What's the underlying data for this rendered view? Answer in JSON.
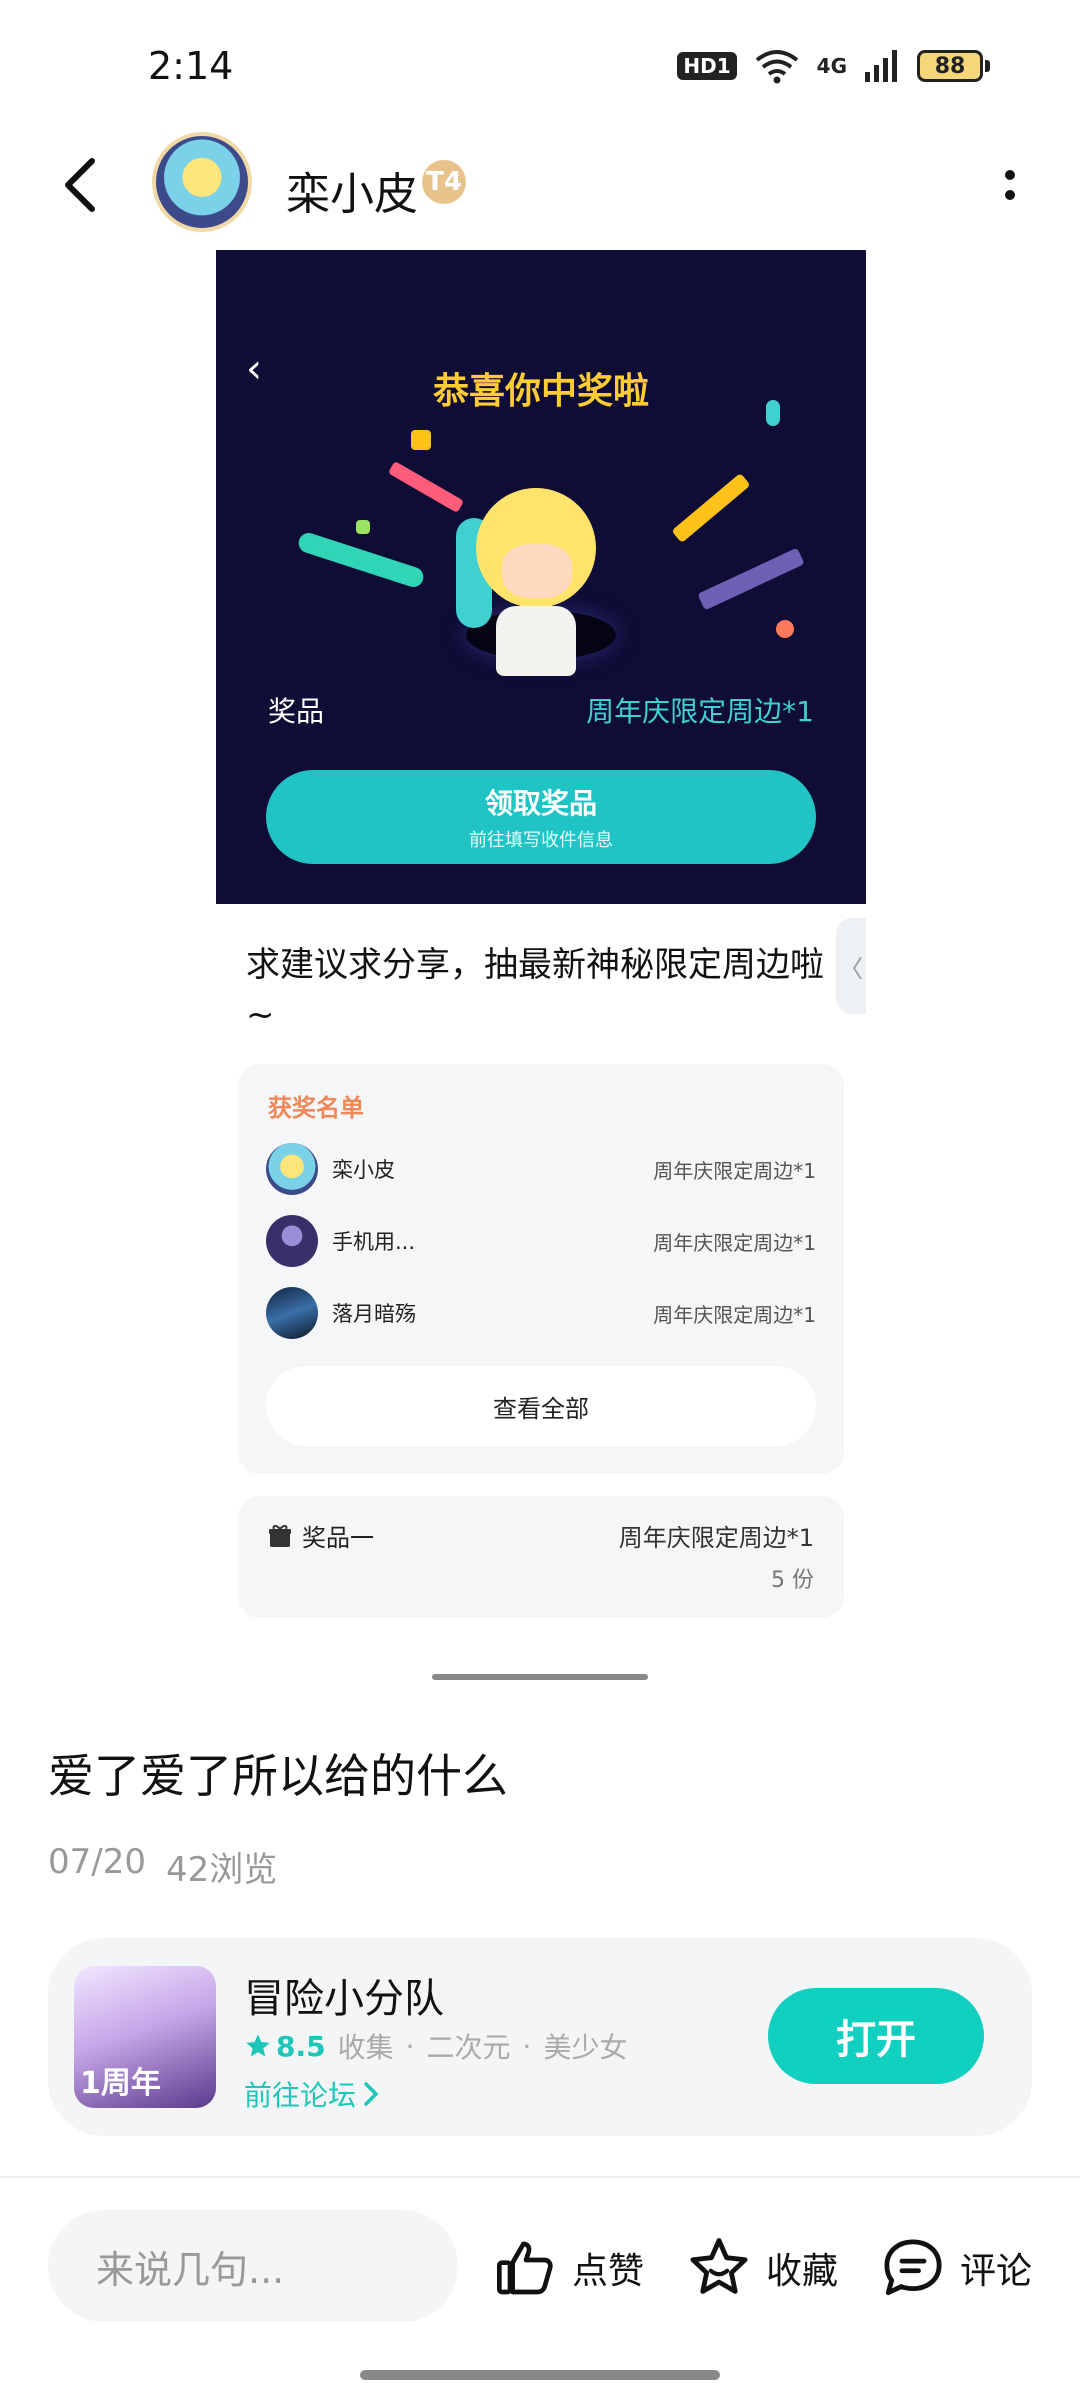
{
  "status_bar": {
    "time": "2:14",
    "network": "4G",
    "hd_label": "HD1",
    "battery": "88"
  },
  "header": {
    "user_name": "栾小皮",
    "level": "T4"
  },
  "post_image": {
    "title": "恭喜你中奖啦",
    "prize_label": "奖品",
    "prize_value": "周年庆限定周边*1",
    "claim_button": "领取奖品",
    "claim_sub": "前往填写收件信息",
    "description": "求建议求分享，抽最新神秘限定周边啦~",
    "side_handle": "〈",
    "winners_title": "获奖名单",
    "winners": [
      {
        "name": "栾小皮",
        "prize": "周年庆限定周边*1"
      },
      {
        "name": "手机用...",
        "prize": "周年庆限定周边*1"
      },
      {
        "name": "落月暗殇",
        "prize": "周年庆限定周边*1"
      }
    ],
    "view_all": "查看全部",
    "prize_item_name": "奖品一",
    "prize_item_value": "周年庆限定周边*1",
    "prize_item_count": "5 份"
  },
  "post": {
    "title": "爱了爱了所以给的什么",
    "date": "07/20",
    "views": "42浏览"
  },
  "app_card": {
    "name": "冒险小分队",
    "rating": "8.5",
    "tags": [
      "收集",
      "二次元",
      "美少女"
    ],
    "forum_link": "前往论坛",
    "open_button": "打开",
    "icon_badge": "1周年"
  },
  "bottom_bar": {
    "comment_placeholder": "来说几句...",
    "like": "点赞",
    "favorite": "收藏",
    "comment": "评论"
  },
  "colors": {
    "accent": "#12d0c0",
    "prize_bg": "#0f0c35",
    "title_yellow": "#ffcc33",
    "winners_orange": "#f0885a"
  }
}
